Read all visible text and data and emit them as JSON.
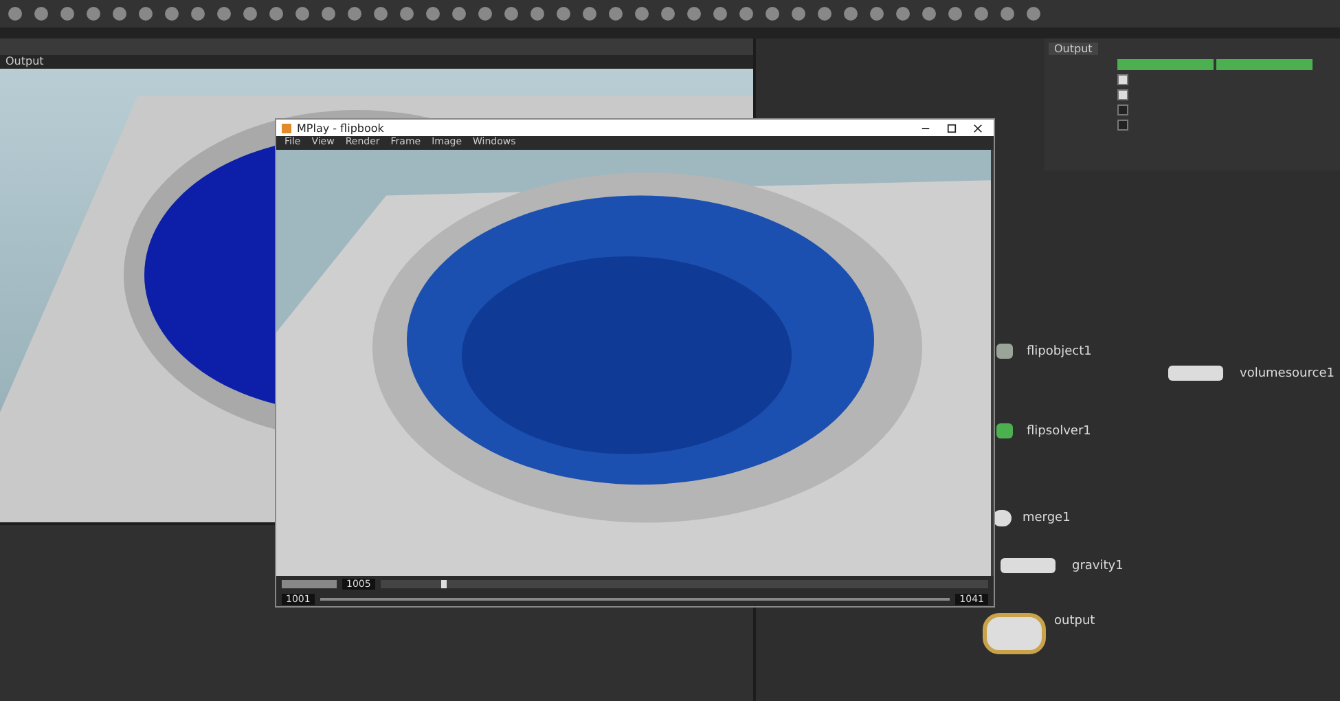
{
  "viewport": {
    "label": "Output"
  },
  "mplay": {
    "title": "MPlay - flipbook",
    "menu": [
      "File",
      "View",
      "Render",
      "Frame",
      "Image",
      "Windows"
    ],
    "frame": "1005",
    "start": "1001",
    "end": "1041",
    "level": 0.1
  },
  "parameters": {
    "tab": "Output",
    "checkboxes": [
      {
        "checked": true
      },
      {
        "checked": true
      },
      {
        "checked": false
      },
      {
        "checked": false
      }
    ]
  },
  "nodes": [
    {
      "name": "flipobject1",
      "kind": "object"
    },
    {
      "name": "volumesource1",
      "kind": "source"
    },
    {
      "name": "flipsolver1",
      "kind": "solver"
    },
    {
      "name": "merge1",
      "kind": "merge"
    },
    {
      "name": "gravity1",
      "kind": "force"
    },
    {
      "name": "output",
      "kind": "output"
    }
  ]
}
